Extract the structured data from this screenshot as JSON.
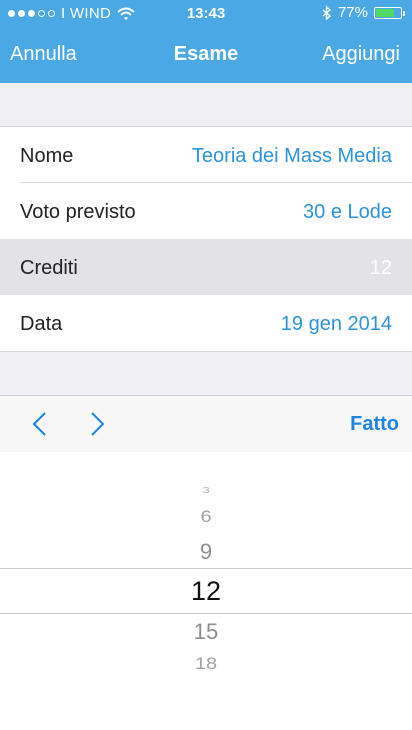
{
  "status_bar": {
    "carrier": "I WIND",
    "time": "13:43",
    "battery": "77%",
    "battery_level": 0.77
  },
  "nav": {
    "left_button": "Annulla",
    "title": "Esame",
    "right_button": "Aggiungi"
  },
  "form": {
    "rows": [
      {
        "label": "Nome",
        "value": "Teoria dei Mass Media"
      },
      {
        "label": "Voto previsto",
        "value": "30 e Lode"
      },
      {
        "label": "Crediti",
        "value": "12"
      },
      {
        "label": "Data",
        "value": "19 gen 2014"
      }
    ]
  },
  "toolbar": {
    "prev_icon": "chevron-left-icon",
    "next_icon": "chevron-right-icon",
    "done_label": "Fatto"
  },
  "picker": {
    "items": [
      "3",
      "6",
      "9",
      "12",
      "15",
      "18"
    ],
    "selected": "12"
  },
  "colors": {
    "nav_background": "#4aa9e5",
    "accent": "#2b94d8",
    "done": "#1d83e3",
    "battery_fill": "#4cd964"
  }
}
